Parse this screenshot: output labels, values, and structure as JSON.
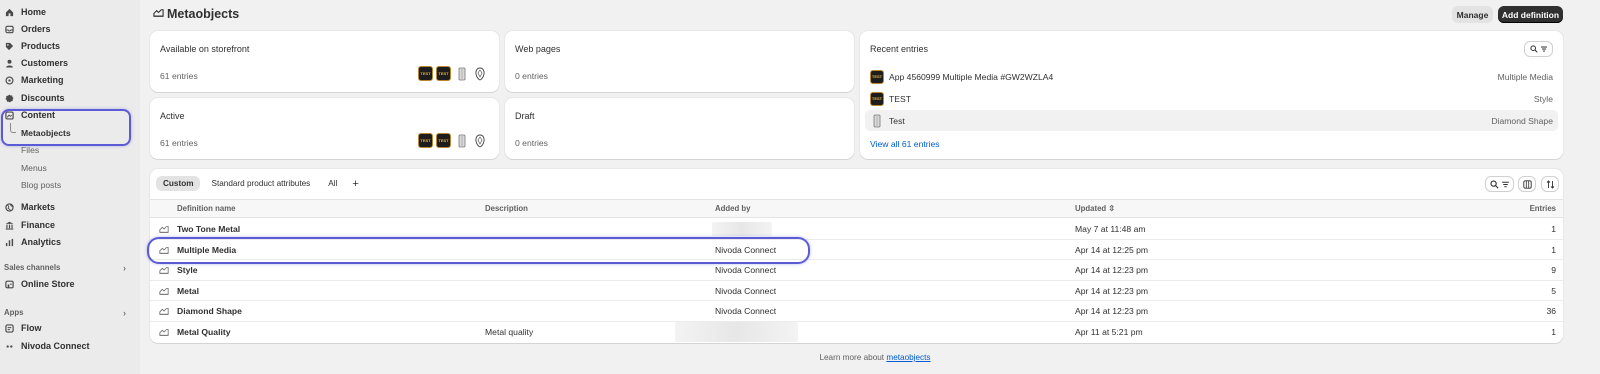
{
  "sidebar": {
    "items": [
      {
        "label": "Home",
        "icon": "home-icon"
      },
      {
        "label": "Orders",
        "icon": "inbox-icon"
      },
      {
        "label": "Products",
        "icon": "tag-icon"
      },
      {
        "label": "Customers",
        "icon": "person-icon"
      },
      {
        "label": "Marketing",
        "icon": "target-icon"
      },
      {
        "label": "Discounts",
        "icon": "discount-icon"
      },
      {
        "label": "Content",
        "icon": "content-icon"
      }
    ],
    "content_sub": [
      "Metaobjects",
      "Files",
      "Menus",
      "Blog posts"
    ],
    "items2": [
      {
        "label": "Markets",
        "icon": "globe-icon"
      },
      {
        "label": "Finance",
        "icon": "bank-icon"
      },
      {
        "label": "Analytics",
        "icon": "chart-icon"
      }
    ],
    "sales_channels_heading": "Sales channels",
    "online_store": "Online Store",
    "apps_heading": "Apps",
    "flow": "Flow",
    "nivoda": "Nivoda Connect"
  },
  "header": {
    "title": "Metaobjects",
    "manage": "Manage",
    "add_definition": "Add definition"
  },
  "cards": {
    "storefront": {
      "title": "Available on storefront",
      "sub": "61 entries"
    },
    "webpages": {
      "title": "Web pages",
      "sub": "0 entries"
    },
    "active": {
      "title": "Active",
      "sub": "61 entries"
    },
    "draft": {
      "title": "Draft",
      "sub": "0 entries"
    },
    "thumb_text": "TEST"
  },
  "recent": {
    "title": "Recent entries",
    "rows": [
      {
        "name": "App 4560999 Multiple Media #GW2WZLA4",
        "type": "Multiple Media"
      },
      {
        "name": "TEST",
        "type": "Style"
      },
      {
        "name": "Test",
        "type": "Diamond Shape"
      }
    ],
    "view_all": "View all 61 entries"
  },
  "table": {
    "tabs": [
      "Custom",
      "Standard product attributes",
      "All",
      "+"
    ],
    "headers": {
      "name": "Definition name",
      "description": "Description",
      "added_by": "Added by",
      "updated": "Updated",
      "entries": "Entries"
    },
    "rows": [
      {
        "name": "Two Tone Metal",
        "description": "",
        "added_by": "",
        "updated": "May 7 at 11:48 am",
        "entries": "1"
      },
      {
        "name": "Multiple Media",
        "description": "",
        "added_by": "Nivoda Connect",
        "updated": "Apr 14 at 12:25 pm",
        "entries": "1"
      },
      {
        "name": "Style",
        "description": "",
        "added_by": "Nivoda Connect",
        "updated": "Apr 14 at 12:23 pm",
        "entries": "9"
      },
      {
        "name": "Metal",
        "description": "",
        "added_by": "Nivoda Connect",
        "updated": "Apr 14 at 12:23 pm",
        "entries": "5"
      },
      {
        "name": "Diamond Shape",
        "description": "",
        "added_by": "Nivoda Connect",
        "updated": "Apr 14 at 12:23 pm",
        "entries": "36"
      },
      {
        "name": "Metal Quality",
        "description": "Metal quality",
        "added_by": "",
        "updated": "Apr 11 at 5:21 pm",
        "entries": "1"
      }
    ]
  },
  "footer": {
    "prefix": "Learn more about ",
    "link": "metaobjects"
  }
}
